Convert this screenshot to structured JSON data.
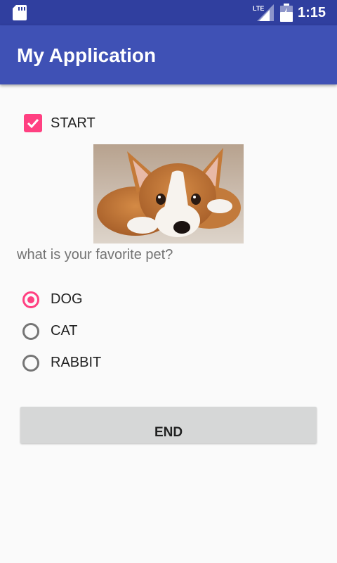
{
  "status_bar": {
    "network_label": "LTE",
    "time": "1:15",
    "icons": [
      "sd-card-icon",
      "lte-signal-icon",
      "battery-icon"
    ]
  },
  "app_bar": {
    "title": "My Application",
    "color": "#3F51B5"
  },
  "start_checkbox": {
    "label": "START",
    "checked": true
  },
  "pet_image": {
    "description_name": "corgi-puppy-image"
  },
  "question": {
    "text": "what is your favorite pet?"
  },
  "pet_options": [
    {
      "label": "DOG",
      "checked": true
    },
    {
      "label": "CAT",
      "checked": false
    },
    {
      "label": "RABBIT",
      "checked": false
    }
  ],
  "end_button": {
    "label": "END"
  },
  "colors": {
    "accent": "#FF4081",
    "status_bar": "#303F9F",
    "primary": "#3F51B5"
  }
}
